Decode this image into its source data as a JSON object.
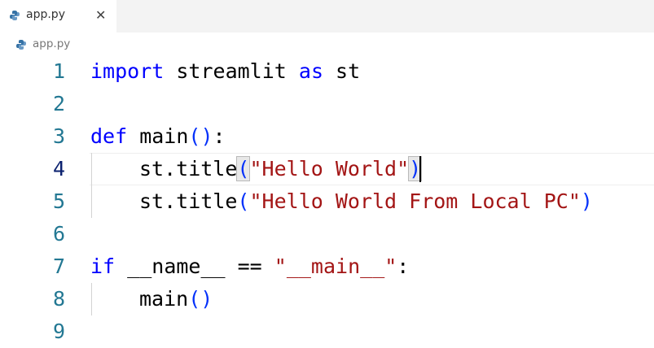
{
  "tab": {
    "label": "app.py",
    "icon": "python-icon",
    "close_label": "✕"
  },
  "breadcrumb": {
    "label": "app.py",
    "icon": "python-icon"
  },
  "editor": {
    "active_line": 4,
    "line_numbers": [
      "1",
      "2",
      "3",
      "4",
      "5",
      "6",
      "7",
      "8",
      "9"
    ],
    "lines": {
      "l1": {
        "kw1": "import",
        "t1": " streamlit ",
        "kw2": "as",
        "t2": " st"
      },
      "l3": {
        "kw1": "def",
        "t1": " main",
        "b1": "(",
        "b2": ")",
        "t2": ":"
      },
      "l4": {
        "t1": "st.title",
        "b1": "(",
        "s1": "\"Hello World\"",
        "b2": ")"
      },
      "l5": {
        "t1": "st.title",
        "b1": "(",
        "s1": "\"Hello World From Local PC\"",
        "b2": ")"
      },
      "l7": {
        "kw1": "if",
        "t1": " __name__ == ",
        "s1": "\"__main__\"",
        "t2": ":"
      },
      "l8": {
        "t1": "main",
        "b1": "(",
        "b2": ")"
      }
    }
  },
  "colors": {
    "keyword": "#0000ff",
    "string": "#a31515",
    "bracket": "#0431fa",
    "line_number": "#237893",
    "active_line_number": "#0b216f"
  }
}
